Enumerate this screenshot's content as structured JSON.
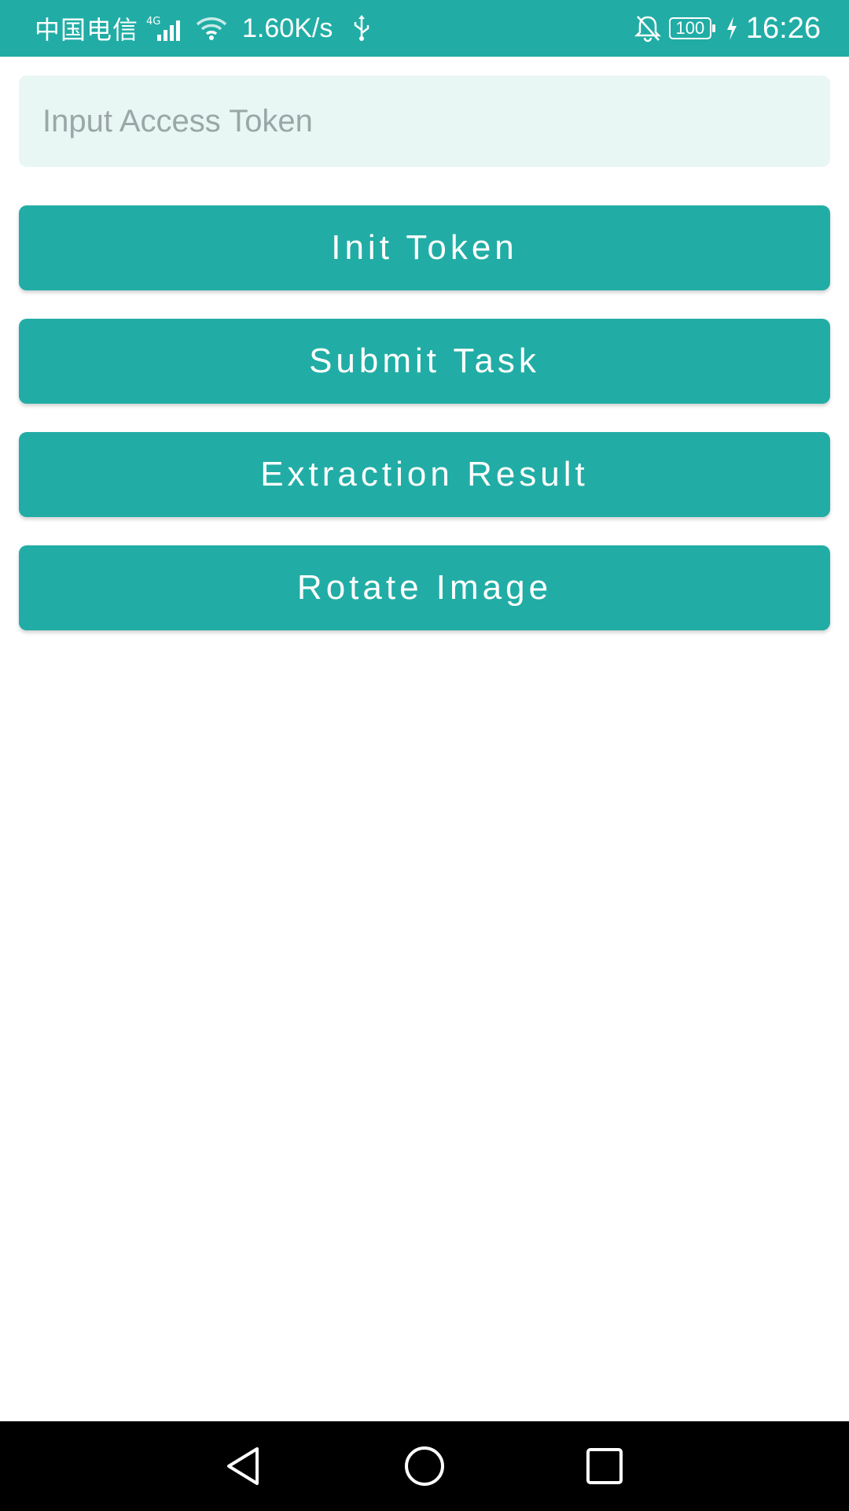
{
  "status_bar": {
    "carrier": "中国电信",
    "network_type": "4G",
    "net_speed": "1.60K/s",
    "battery": "100",
    "time": "16:26",
    "icons": [
      "signal-icon",
      "wifi-icon",
      "usb-icon",
      "bell-off-icon",
      "battery-icon",
      "charging-icon"
    ]
  },
  "main": {
    "token_input": {
      "placeholder": "Input Access Token",
      "value": ""
    },
    "buttons": [
      {
        "label": "Init Token"
      },
      {
        "label": "Submit Task"
      },
      {
        "label": "Extraction Result"
      },
      {
        "label": "Rotate Image"
      }
    ]
  },
  "nav_bar": {
    "icons": [
      "back-icon",
      "home-icon",
      "recent-apps-icon"
    ]
  },
  "colors": {
    "accent": "#21ada5",
    "input_background": "#e8f6f4",
    "nav_background": "#000000"
  }
}
